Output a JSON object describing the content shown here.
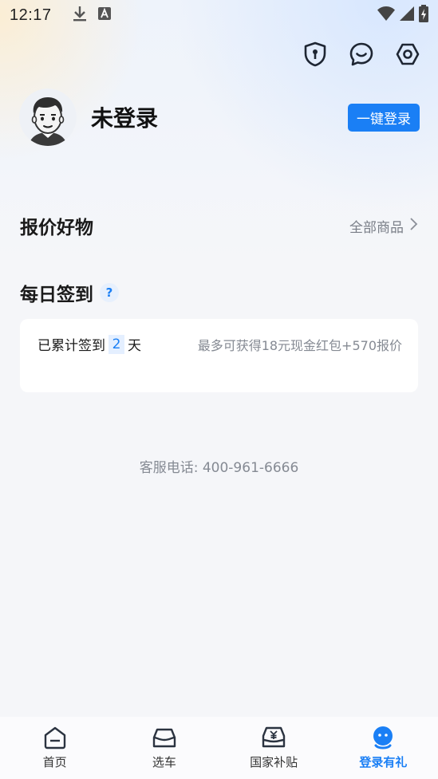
{
  "status_bar": {
    "time": "12:17",
    "icons": [
      "download-icon",
      "keyboard-a-icon",
      "wifi-icon",
      "signal-icon",
      "battery-charging-icon"
    ]
  },
  "header_icons": [
    "shield-lock-icon",
    "chat-bubble-icon",
    "settings-hexagon-icon"
  ],
  "profile": {
    "avatar": "cartoon-avatar",
    "title": "未登录",
    "login_button": "一键登录"
  },
  "goods": {
    "title": "报价好物",
    "see_all": "全部商品"
  },
  "daily_sign": {
    "title": "每日签到",
    "help": "?",
    "prefix": "已累计签到",
    "days": "2",
    "suffix": "天",
    "reward": "最多可获得18元现金红包+570报价"
  },
  "hotline": "客服电话: 400-961-6666",
  "tabs": [
    {
      "label": "首页",
      "icon": "home-icon",
      "active": false
    },
    {
      "label": "选车",
      "icon": "car-icon",
      "active": false
    },
    {
      "label": "国家补贴",
      "icon": "subsidy-car-icon",
      "active": false
    },
    {
      "label": "登录有礼",
      "icon": "face-icon",
      "active": true
    }
  ],
  "colors": {
    "accent": "#1a7ff5",
    "background": "#f5f6f9",
    "muted_text": "#858a93"
  }
}
